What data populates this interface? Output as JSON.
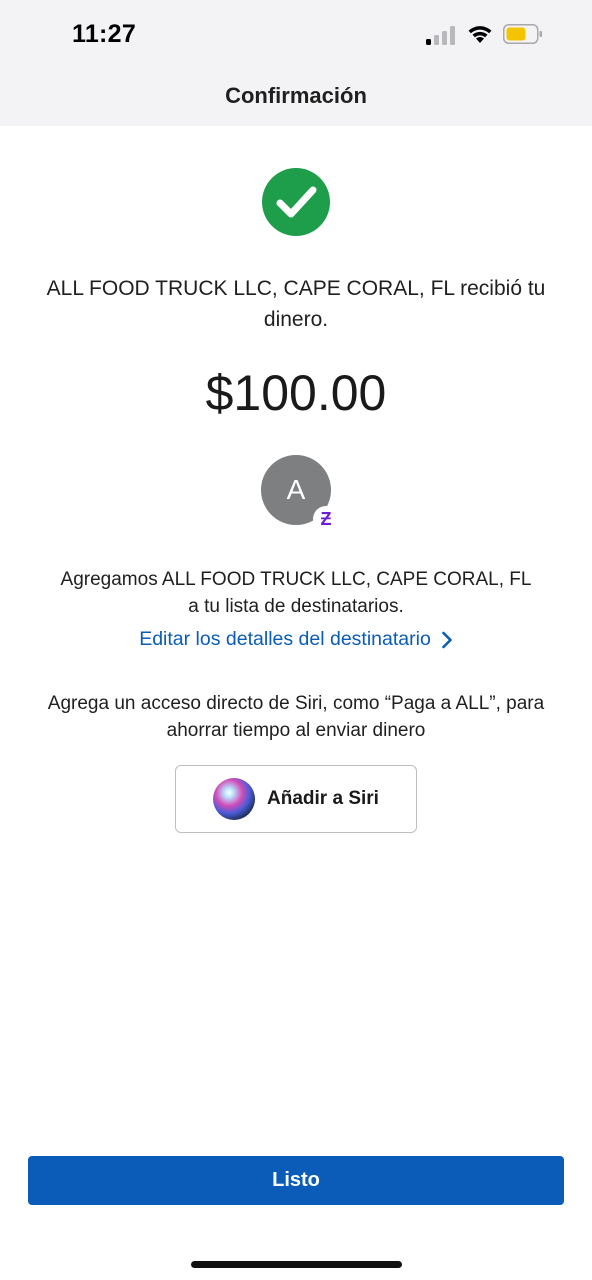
{
  "status_bar": {
    "time": "11:27",
    "signal_icon": "cellular-signal-icon",
    "wifi_icon": "wifi-icon",
    "battery_icon": "battery-icon",
    "battery_color": "#f5c400"
  },
  "nav": {
    "title": "Confirmación"
  },
  "confirmation": {
    "success_icon": "checkmark-circle-icon",
    "success_color": "#1e9e4a",
    "message": "ALL FOOD TRUCK LLC, CAPE CORAL, FL recibió tu dinero.",
    "amount": "$100.00"
  },
  "recipient": {
    "avatar_initial": "A",
    "badge_icon": "zelle-icon",
    "badge_symbol": "Ƶ",
    "badge_color": "#6d1ed4",
    "added_message": "Agregamos ALL FOOD TRUCK LLC, CAPE CORAL, FL a tu lista de destinatarios.",
    "edit_link": "Editar los detalles del destinatario",
    "link_color": "#0a5cb8"
  },
  "siri": {
    "message": "Agrega un acceso directo de Siri, como “Paga a ALL”, para ahorrar tiempo al enviar dinero",
    "button_label": "Añadir a Siri",
    "button_icon": "siri-icon"
  },
  "footer": {
    "done_label": "Listo",
    "button_color": "#0a5cb8"
  }
}
